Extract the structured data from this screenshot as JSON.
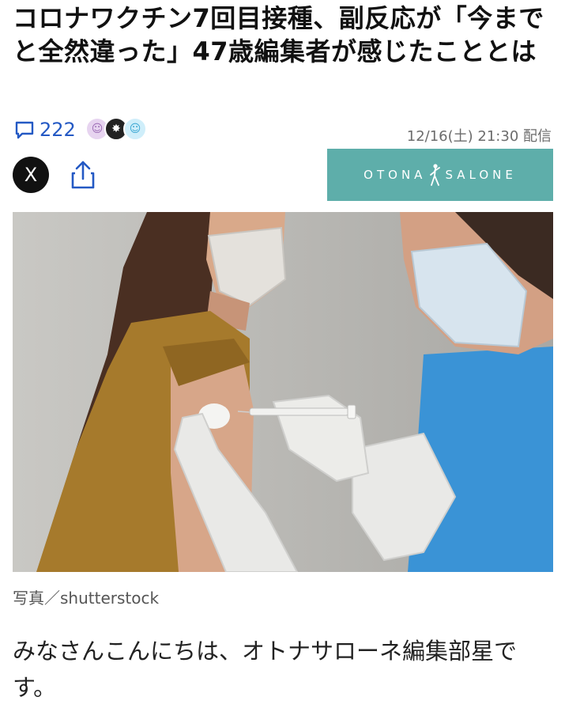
{
  "article": {
    "title": "コロナワクチン7回目接種、副反応が「今までと全然違った」47歳編集者が感じたこととは",
    "comment_count": "222",
    "date": "12/16(土) 21:30 配信",
    "brand": {
      "part1": "OTONA",
      "part2": "SALONE"
    },
    "caption": "写真／shutterstock",
    "body": "みなさんこんにちは、オトナサローネ編集部星です。"
  },
  "share": {
    "x_label": "X"
  },
  "icons": {
    "comment": "comment-bubble-icon",
    "share": "share-upload-icon",
    "x": "x-logo-icon"
  },
  "colors": {
    "link_blue": "#2459c4",
    "brand_teal": "#5eaeaa"
  }
}
